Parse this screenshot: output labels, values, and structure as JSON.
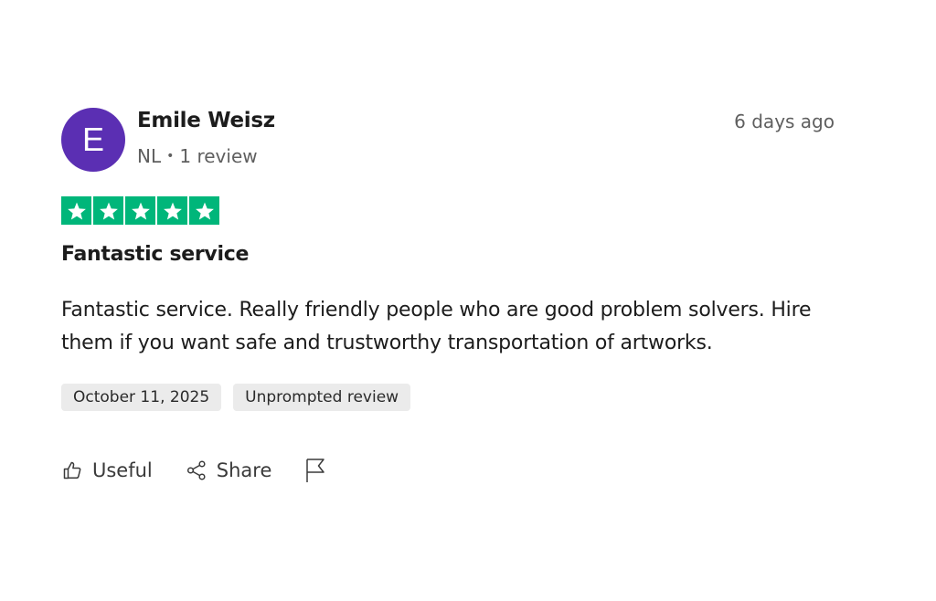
{
  "reviewer": {
    "initial": "E",
    "name": "Emile Weisz",
    "country": "NL",
    "separator": "•",
    "review_count": "1 review",
    "avatar_color": "#5b2fb3"
  },
  "review": {
    "age": "6 days ago",
    "rating": 5,
    "rating_max": 5,
    "star_color": "#00b67a",
    "title": "Fantastic service",
    "body": "Fantastic service. Really friendly people who are good problem solvers. Hire them if you want safe and trustworthy transportation of artworks.",
    "tags": {
      "date": "October 11, 2025",
      "type": "Unprompted review"
    }
  },
  "actions": {
    "useful_label": "Useful",
    "share_label": "Share",
    "useful_icon": "thumbs-up-icon",
    "share_icon": "share-icon",
    "report_icon": "flag-icon"
  }
}
